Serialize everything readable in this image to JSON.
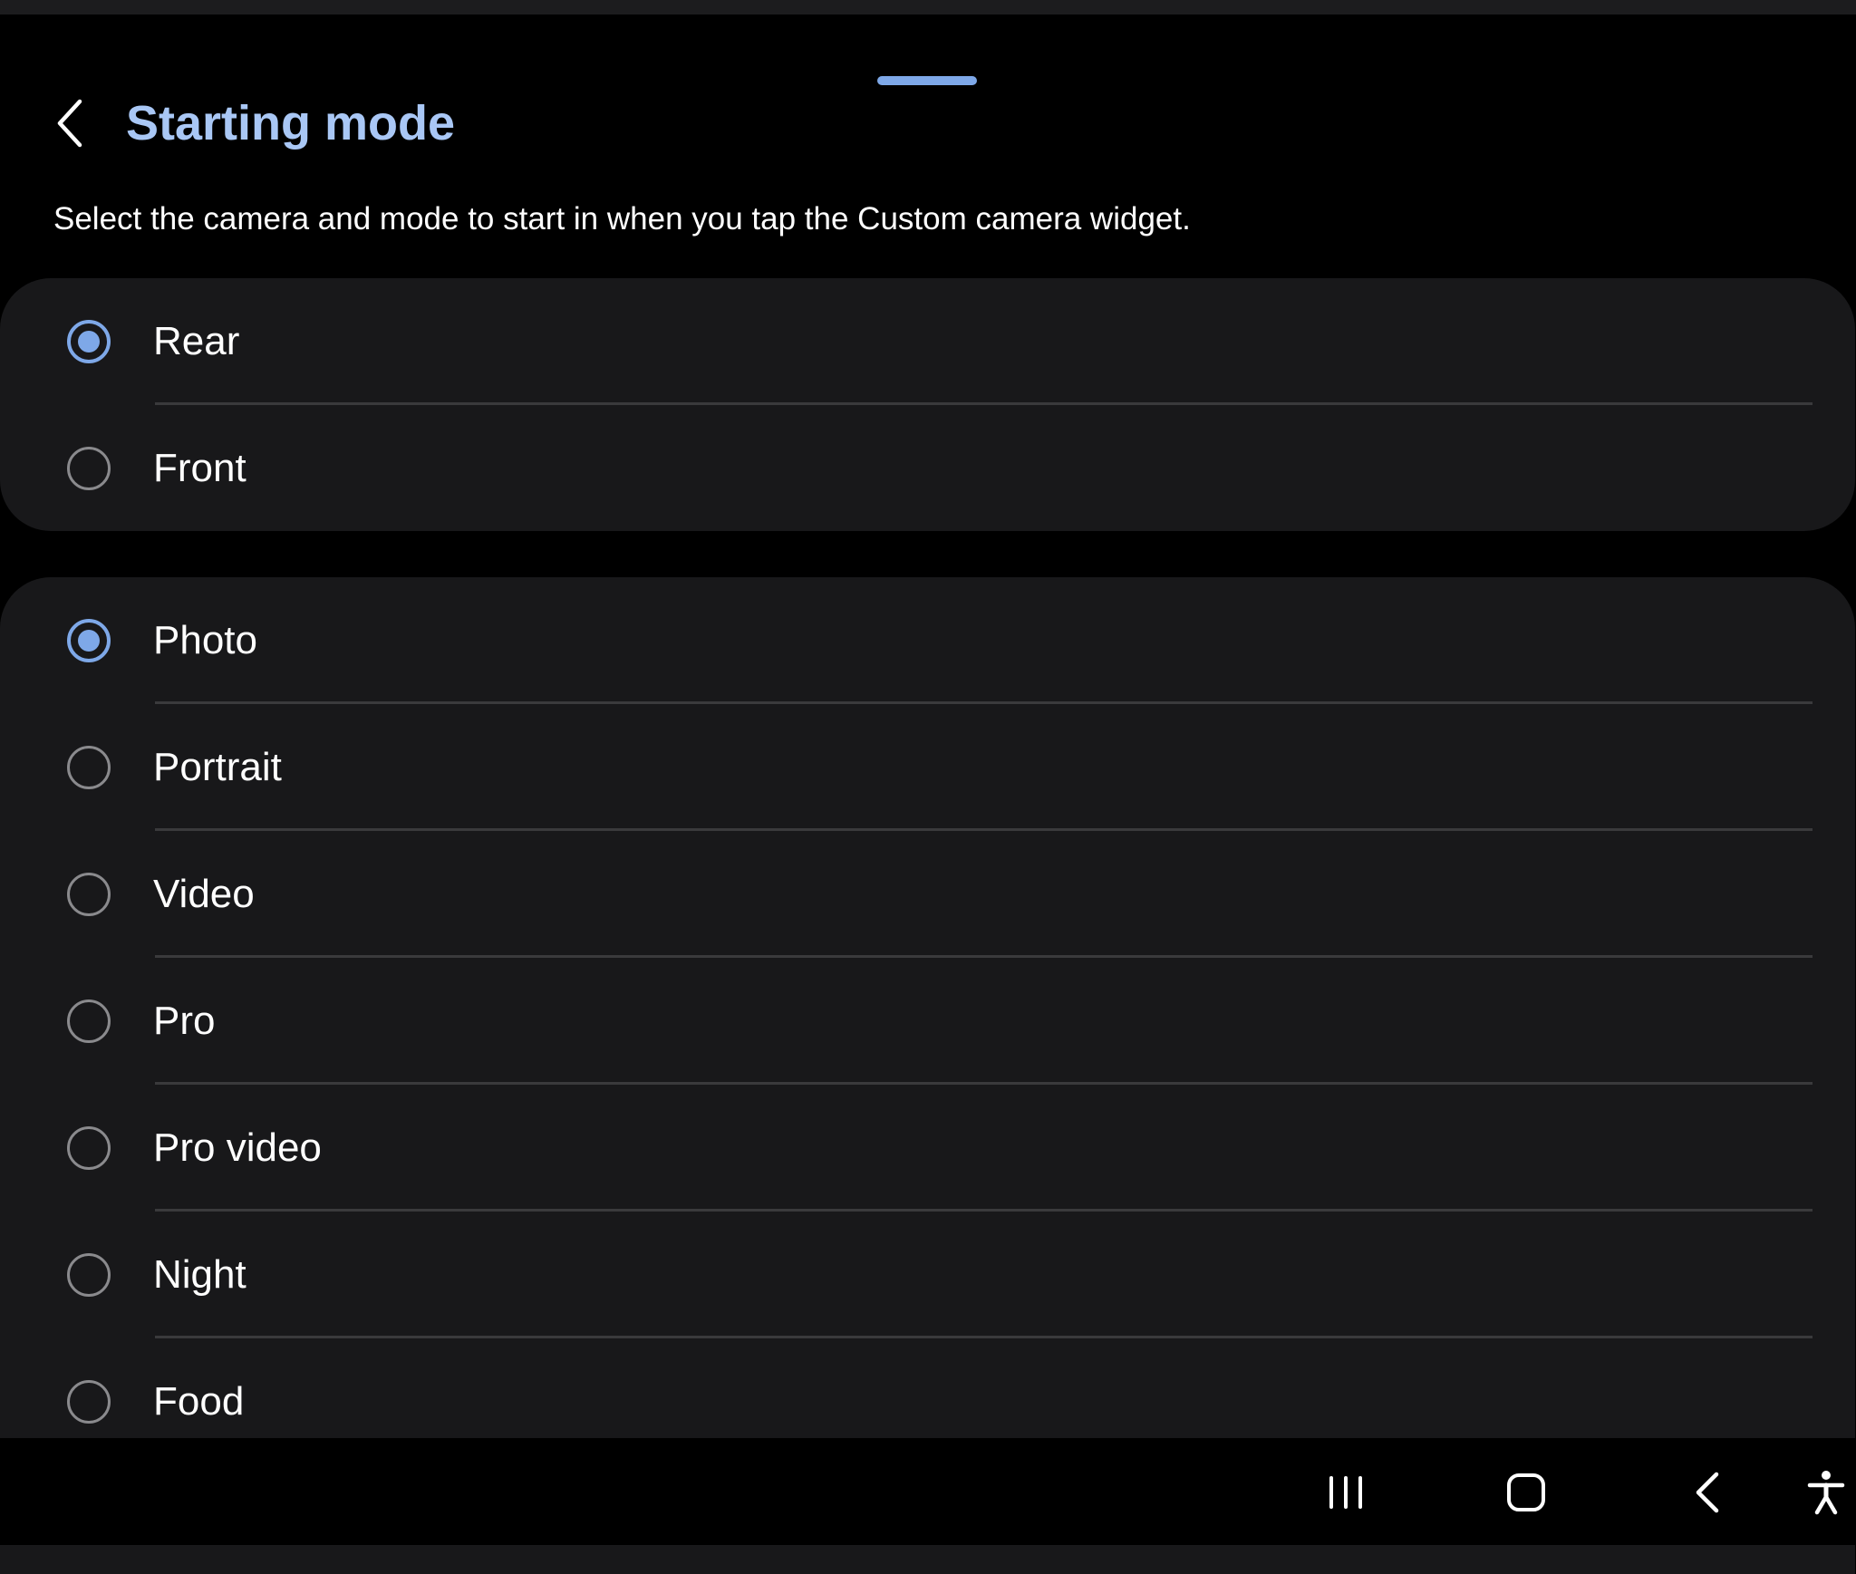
{
  "header": {
    "title": "Starting mode",
    "back_icon": "chevron-left-icon"
  },
  "description": "Select the camera and mode to start in when you tap the Custom camera widget.",
  "camera_options": [
    {
      "label": "Rear",
      "selected": true
    },
    {
      "label": "Front",
      "selected": false
    }
  ],
  "mode_options": [
    {
      "label": "Photo",
      "selected": true
    },
    {
      "label": "Portrait",
      "selected": false
    },
    {
      "label": "Video",
      "selected": false
    },
    {
      "label": "Pro",
      "selected": false
    },
    {
      "label": "Pro video",
      "selected": false
    },
    {
      "label": "Night",
      "selected": false
    },
    {
      "label": "Food",
      "selected": false
    }
  ],
  "nav_bar": {
    "recents_icon": "recents-icon",
    "home_icon": "home-icon",
    "back_icon": "back-icon",
    "accessibility_icon": "accessibility-icon"
  },
  "colors": {
    "accent": "#7ea8e8",
    "title": "#a9c7f5",
    "card_background": "#18181a",
    "background": "#000000"
  }
}
